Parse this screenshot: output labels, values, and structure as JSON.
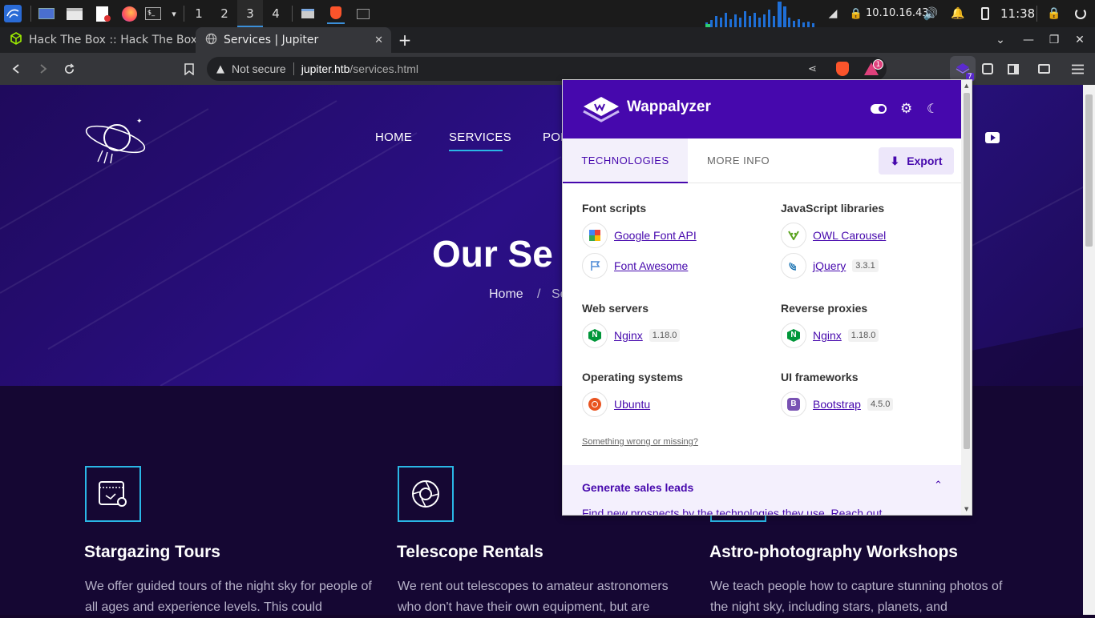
{
  "taskbar": {
    "workspaces": [
      "1",
      "2",
      "3",
      "4"
    ],
    "ip": "10.10.16.43",
    "time": "11:38"
  },
  "tabs": [
    {
      "label": "Hack The Box :: Hack The Box"
    },
    {
      "label": "Services | Jupiter"
    }
  ],
  "toolbar": {
    "security": "Not secure",
    "url_host": "jupiter.htb",
    "url_path": "/services.html",
    "brave_badge": "1",
    "wappalyzer_badge": "7"
  },
  "site": {
    "nav": [
      "HOME",
      "SERVICES",
      "POR"
    ],
    "hero_title": "Our Se",
    "breadcrumb_home": "Home",
    "breadcrumb_sep": "/",
    "breadcrumb_current": "Se",
    "cards": [
      {
        "title": "Stargazing Tours",
        "text": "We offer guided tours of the night sky for people of all ages and experience levels. This could"
      },
      {
        "title": "Telescope Rentals",
        "text": "We rent out telescopes to amateur astronomers who don't have their own equipment, but are"
      },
      {
        "title": "Astro-photography Workshops",
        "text": "We teach people how to capture stunning photos of the night sky, including stars, planets, and"
      }
    ]
  },
  "wappalyzer": {
    "brand": "Wappalyzer",
    "tab_technologies": "TECHNOLOGIES",
    "tab_more_info": "MORE INFO",
    "export": "Export",
    "categories": [
      {
        "name": "Font scripts",
        "items": [
          {
            "name": "Google Font API",
            "version": ""
          },
          {
            "name": "Font Awesome",
            "version": ""
          }
        ]
      },
      {
        "name": "JavaScript libraries",
        "items": [
          {
            "name": "OWL Carousel",
            "version": ""
          },
          {
            "name": "jQuery",
            "version": "3.3.1"
          }
        ]
      },
      {
        "name": "Web servers",
        "items": [
          {
            "name": "Nginx",
            "version": "1.18.0"
          }
        ]
      },
      {
        "name": "Reverse proxies",
        "items": [
          {
            "name": "Nginx",
            "version": "1.18.0"
          }
        ]
      },
      {
        "name": "Operating systems",
        "items": [
          {
            "name": "Ubuntu",
            "version": ""
          }
        ]
      },
      {
        "name": "UI frameworks",
        "items": [
          {
            "name": "Bootstrap",
            "version": "4.5.0"
          }
        ]
      }
    ],
    "something_wrong": "Something wrong or missing?",
    "leads_title": "Generate sales leads",
    "leads_text": "Find new prospects by the technologies they use. Reach out"
  },
  "colors": {
    "accent": "#4608ad",
    "hero": "#2b0f86",
    "icon_border": "#2ab7e6"
  }
}
